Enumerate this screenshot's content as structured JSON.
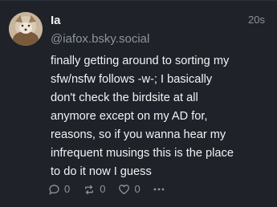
{
  "post": {
    "author": {
      "display_name": "Ia",
      "handle": "@iafox.bsky.social",
      "avatar_icon": "avatar-image"
    },
    "timestamp": "20s",
    "text_lines": [
      "finally getting around to sorting my",
      "sfw/nsfw follows -w-; I basically",
      "don't check the birdsite at all",
      "anymore except on my AD for,",
      "reasons, so if you wanna hear my",
      "infrequent musings this is the place",
      "to do it now I guess"
    ],
    "actions": {
      "reply": {
        "icon": "reply-bubble-icon",
        "count": "0"
      },
      "repost": {
        "icon": "repost-arrows-icon",
        "count": "0"
      },
      "like": {
        "icon": "heart-icon",
        "count": "0"
      },
      "more": {
        "icon": "more-dots-icon"
      }
    }
  },
  "colors": {
    "background": "#1f2228",
    "text_primary": "#f1f3f5",
    "text_muted": "#8d949e"
  }
}
